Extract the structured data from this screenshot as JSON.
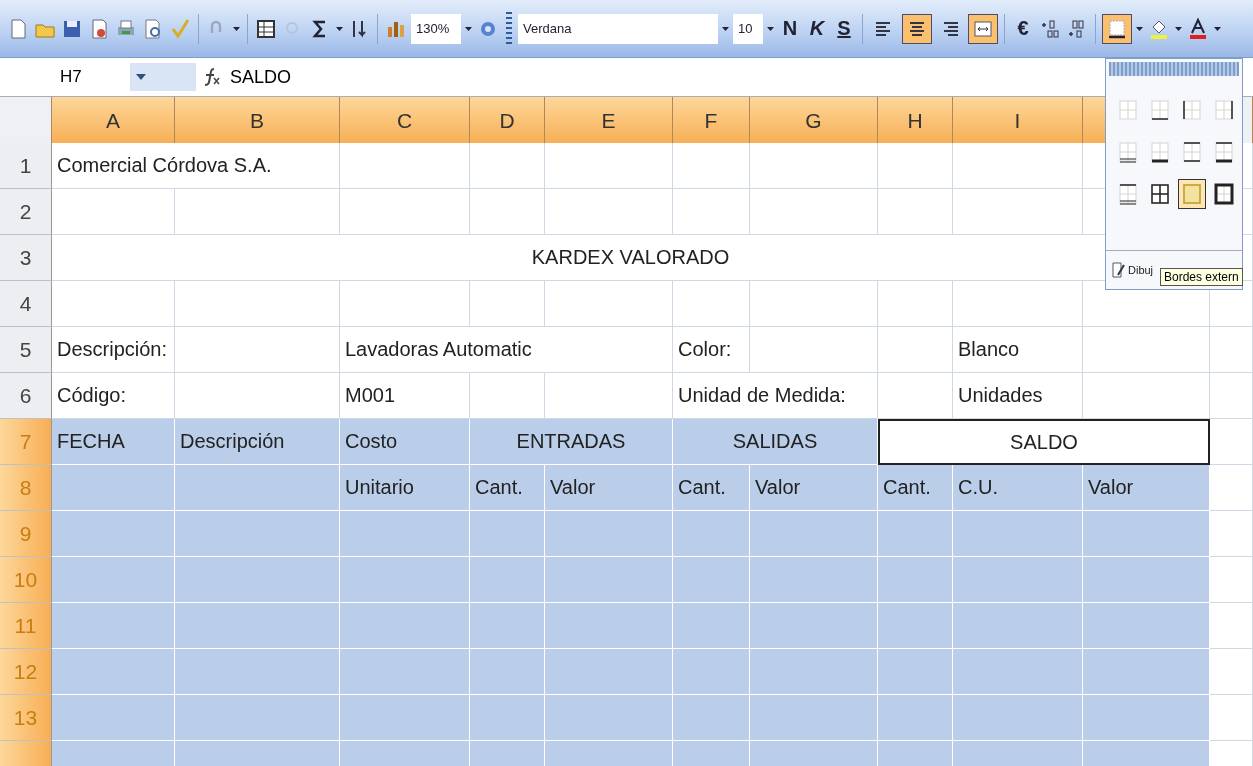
{
  "toolbar": [
    {
      "kind": "new"
    },
    {
      "kind": "open"
    },
    {
      "kind": "save"
    },
    {
      "kind": "permission"
    },
    {
      "kind": "print"
    },
    {
      "kind": "preview"
    },
    {
      "kind": "spelling"
    },
    {
      "kind": "separator"
    },
    {
      "kind": "undo"
    },
    {
      "kind": "dropdown"
    },
    {
      "kind": "separator"
    },
    {
      "kind": "table"
    },
    {
      "kind": "disabled"
    },
    {
      "kind": "sum"
    },
    {
      "kind": "dropdown"
    },
    {
      "kind": "sort"
    },
    {
      "kind": "separator"
    },
    {
      "kind": "chart"
    },
    {
      "kind": "zoom-field",
      "text": "130%"
    },
    {
      "kind": "dropdown"
    },
    {
      "kind": "help"
    },
    {
      "kind": "grip"
    },
    {
      "kind": "font-field",
      "text": "Verdana"
    },
    {
      "kind": "dropdown"
    },
    {
      "kind": "size-field",
      "text": "10"
    },
    {
      "kind": "dropdown"
    },
    {
      "kind": "bold",
      "text": "N"
    },
    {
      "kind": "italic",
      "text": "K"
    },
    {
      "kind": "underline",
      "text": "S"
    },
    {
      "kind": "separator"
    },
    {
      "kind": "align-left",
      "selected": false
    },
    {
      "kind": "align-center",
      "selected": true
    },
    {
      "kind": "align-right",
      "selected": false
    },
    {
      "kind": "merge",
      "selected": true
    },
    {
      "kind": "separator"
    },
    {
      "kind": "currency",
      "text": "€"
    },
    {
      "kind": "inc-decimal"
    },
    {
      "kind": "dec-decimal"
    },
    {
      "kind": "separator"
    },
    {
      "kind": "borders",
      "selected": true
    },
    {
      "kind": "dropdown"
    },
    {
      "kind": "fill-color"
    },
    {
      "kind": "dropdown"
    },
    {
      "kind": "font-color"
    },
    {
      "kind": "dropdown"
    }
  ],
  "formula_bar": {
    "name_box": "H7",
    "formula": "SALDO"
  },
  "columns": [
    {
      "label": "A",
      "selected": true
    },
    {
      "label": "B",
      "selected": true
    },
    {
      "label": "C",
      "selected": true
    },
    {
      "label": "D",
      "selected": true
    },
    {
      "label": "E",
      "selected": true
    },
    {
      "label": "F",
      "selected": true
    },
    {
      "label": "G",
      "selected": true
    },
    {
      "label": "H",
      "selected": true
    },
    {
      "label": "I",
      "selected": true
    },
    {
      "selected": true
    }
  ],
  "rows": [
    {
      "number": "1",
      "selected": false,
      "shaded": false,
      "cells": [
        {
          "text": "Comercial Córdova S.A."
        },
        {
          "merged": true
        }
      ]
    },
    {
      "number": "2",
      "selected": false,
      "shaded": false,
      "cells": []
    },
    {
      "number": "3",
      "selected": false,
      "shaded": false,
      "kind": "banner",
      "cells": [
        {
          "text": "KARDEX VALORADO"
        }
      ]
    },
    {
      "number": "4",
      "selected": false,
      "shaded": false,
      "cells": []
    },
    {
      "number": "5",
      "selected": false,
      "shaded": false,
      "cells": [
        {
          "text": "Descripción:"
        },
        {},
        {
          "text": "Lavadoras Automatic"
        },
        {
          "merged": true
        },
        {
          "merged": true
        },
        {
          "text": "Color:"
        },
        {},
        {},
        {
          "text": "Blanco"
        }
      ]
    },
    {
      "number": "6",
      "selected": false,
      "shaded": false,
      "cells": [
        {
          "text": "Código:"
        },
        {},
        {
          "text": "M001"
        },
        {},
        {},
        {
          "text": "Unidad de Medida:"
        },
        {
          "merged": true
        },
        {},
        {
          "text": "Unidades"
        }
      ]
    },
    {
      "number": "7",
      "selected": true,
      "shaded": true,
      "cells": [
        {
          "text": "FECHA"
        },
        {
          "text": "Descripción"
        },
        {
          "text": "Costo"
        },
        {
          "text": "ENTRADAS"
        },
        {
          "merged": true
        },
        {
          "text": "SALIDAS"
        },
        {
          "merged": true
        },
        {
          "text": "SALDO",
          "selected": true
        },
        {
          "merged": true
        },
        {
          "merged": true
        }
      ]
    },
    {
      "number": "8",
      "selected": true,
      "shaded": true,
      "cells": [
        {},
        {},
        {
          "text": "Unitario"
        },
        {
          "text": "Cant."
        },
        {
          "text": "Valor"
        },
        {
          "text": "Cant."
        },
        {
          "text": "Valor"
        },
        {
          "text": "Cant."
        },
        {
          "text": "C.U."
        },
        {
          "text": "Valor"
        }
      ]
    },
    {
      "number": "9",
      "selected": true,
      "shaded": true,
      "cells": []
    },
    {
      "number": "10",
      "selected": true,
      "shaded": true,
      "cells": []
    },
    {
      "number": "11",
      "selected": true,
      "shaded": true,
      "cells": []
    },
    {
      "number": "12",
      "selected": true,
      "shaded": true,
      "cells": []
    },
    {
      "number": "13",
      "selected": true,
      "shaded": true,
      "cells": []
    },
    {
      "selected": true,
      "shaded": true,
      "cells": []
    }
  ],
  "border_menu": {
    "options": [
      {
        "kind": "none",
        "selected": false
      },
      {
        "kind": "bottom",
        "selected": false
      },
      {
        "kind": "left",
        "selected": false
      },
      {
        "kind": "right",
        "selected": false
      },
      {
        "kind": "bottom-double",
        "selected": false
      },
      {
        "kind": "bottom-thick",
        "selected": false
      },
      {
        "kind": "top-bottom",
        "selected": false
      },
      {
        "kind": "top-thick-bottom",
        "selected": false
      },
      {
        "kind": "top-double-bottom",
        "selected": false
      },
      {
        "kind": "all",
        "selected": false
      },
      {
        "kind": "outside",
        "selected": true
      },
      {
        "kind": "thick-outside",
        "selected": false
      }
    ],
    "draw_item": "Dibuj",
    "tooltip": "Bordes extern"
  }
}
